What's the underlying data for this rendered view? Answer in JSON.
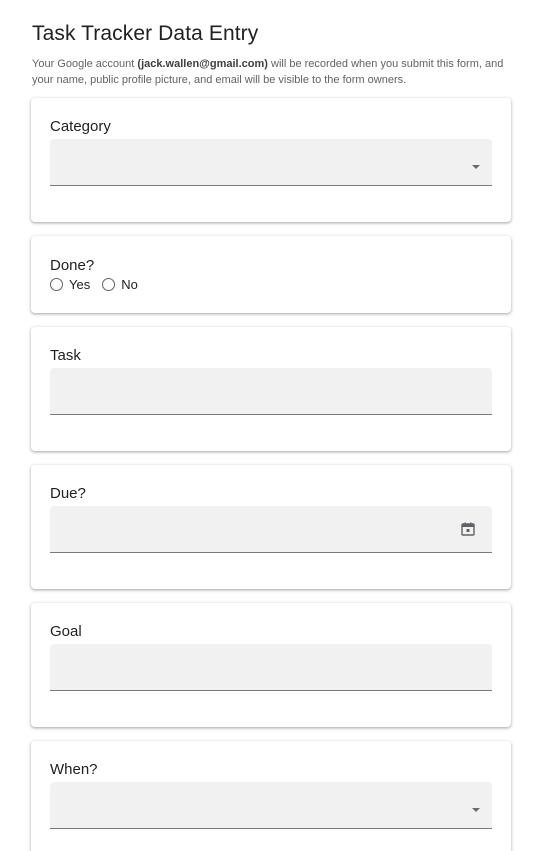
{
  "form": {
    "title": "Task Tracker Data Entry",
    "notice_prefix": "Your Google account ",
    "account_email": "(jack.wallen@gmail.com)",
    "notice_suffix": " will be recorded when you submit this form, and your name, public profile picture, and email will be visible to the form owners."
  },
  "questions": {
    "category": {
      "label": "Category",
      "value": ""
    },
    "done": {
      "label": "Done?",
      "options": [
        "Yes",
        "No"
      ]
    },
    "task": {
      "label": "Task",
      "value": ""
    },
    "due": {
      "label": "Due?",
      "value": "",
      "icon": "calendar-icon"
    },
    "goal": {
      "label": "Goal",
      "value": ""
    },
    "when": {
      "label": "When?",
      "value": ""
    }
  }
}
